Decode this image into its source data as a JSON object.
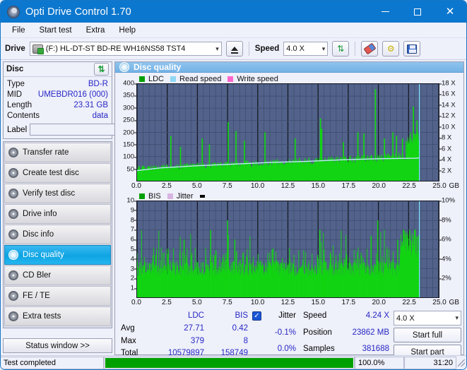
{
  "window": {
    "title": "Opti Drive Control 1.70",
    "icon": "disc-icon",
    "minimize": "—",
    "maximize": "□",
    "close": "✕"
  },
  "menu": [
    {
      "label": "File"
    },
    {
      "label": "Start test"
    },
    {
      "label": "Extra"
    },
    {
      "label": "Help"
    }
  ],
  "toolbar": {
    "drive_label": "Drive",
    "drive_value": "(F:)  HL-DT-ST BD-RE  WH16NS58 TST4",
    "eject_tooltip": "Eject",
    "speed_label": "Speed",
    "speed_value": "4.0 X",
    "refresh_icon": "refresh-icon",
    "erase_icon": "eraser-icon",
    "tools_icon": "wrench-icon",
    "save_icon": "save-icon"
  },
  "disc": {
    "panel_title": "Disc",
    "rows": [
      {
        "key": "Type",
        "value": "BD-R"
      },
      {
        "key": "MID",
        "value": "UMEBDR016 (000)"
      },
      {
        "key": "Length",
        "value": "23.31 GB"
      },
      {
        "key": "Contents",
        "value": "data"
      }
    ],
    "label_key": "Label",
    "label_value": "",
    "label_placeholder": ""
  },
  "nav": {
    "items": [
      {
        "label": "Transfer rate",
        "active": false
      },
      {
        "label": "Create test disc",
        "active": false
      },
      {
        "label": "Verify test disc",
        "active": false
      },
      {
        "label": "Drive info",
        "active": false
      },
      {
        "label": "Disc info",
        "active": false
      },
      {
        "label": "Disc quality",
        "active": true
      },
      {
        "label": "CD Bler",
        "active": false
      },
      {
        "label": "FE / TE",
        "active": false
      },
      {
        "label": "Extra tests",
        "active": false
      }
    ],
    "status_window": "Status window >>"
  },
  "content": {
    "header": "Disc quality",
    "header_icon": "disc-quality-icon"
  },
  "chart_data": [
    {
      "id": "ldc-chart",
      "type": "area",
      "title": "",
      "xlabel": "GB",
      "ylabel": "",
      "xlim": [
        0,
        25.0
      ],
      "ylim": [
        0,
        400
      ],
      "y2lim": [
        0,
        18
      ],
      "grid": true,
      "legend_position": "top-left",
      "xticks": [
        "0.0",
        "2.5",
        "5.0",
        "7.5",
        "10.0",
        "12.5",
        "15.0",
        "17.5",
        "20.0",
        "22.5",
        "25.0"
      ],
      "yticks": [
        "50",
        "100",
        "150",
        "200",
        "250",
        "300",
        "350",
        "400"
      ],
      "y2ticks": [
        "2 X",
        "4 X",
        "6 X",
        "8 X",
        "10 X",
        "12 X",
        "14 X",
        "16 X",
        "18 X"
      ],
      "legend": [
        {
          "name": "LDC",
          "color": "#00a000"
        },
        {
          "name": "Read speed",
          "color": "#8fd6f4"
        },
        {
          "name": "Write speed",
          "color": "#ff66cc"
        }
      ],
      "series": [
        {
          "name": "LDC",
          "color": "#00c000",
          "kind": "spike-area",
          "x_end": 23.4,
          "baseline": [
            48,
            52,
            50,
            54,
            52,
            56,
            54,
            58,
            56,
            60,
            58,
            62,
            60,
            62,
            64,
            62,
            66,
            64,
            68,
            66,
            70,
            68,
            70,
            72,
            70,
            74,
            72,
            74,
            76,
            74,
            78,
            76,
            80,
            78,
            82,
            80,
            84,
            82,
            86,
            84,
            88,
            86,
            90,
            88,
            92,
            90,
            94,
            92,
            96,
            94,
            98,
            100,
            110
          ],
          "max": 379,
          "avg": 27.71,
          "total": 10579897
        },
        {
          "name": "Read speed",
          "color": "#a9e2f7",
          "kind": "line",
          "values_x": [
            0.0,
            2.0,
            5.0,
            8.0,
            11.0,
            14.0,
            17.0,
            20.0,
            23.0,
            23.4
          ],
          "values_y": [
            1.9,
            2.4,
            2.8,
            3.1,
            3.4,
            3.6,
            3.9,
            4.1,
            4.2,
            4.24
          ],
          "units": "X"
        }
      ]
    },
    {
      "id": "bis-chart",
      "type": "area",
      "title": "",
      "xlabel": "GB",
      "ylabel": "",
      "xlim": [
        0,
        25.0
      ],
      "ylim": [
        0,
        10
      ],
      "y2lim": [
        0,
        10
      ],
      "grid": true,
      "legend_position": "top-left",
      "xticks": [
        "0.0",
        "2.5",
        "5.0",
        "7.5",
        "10.0",
        "12.5",
        "15.0",
        "17.5",
        "20.0",
        "22.5",
        "25.0"
      ],
      "yticks": [
        "1",
        "2",
        "3",
        "4",
        "5",
        "6",
        "7",
        "8",
        "9",
        "10"
      ],
      "y2ticks": [
        "2%",
        "4%",
        "6%",
        "8%",
        "10%"
      ],
      "legend": [
        {
          "name": "BIS",
          "color": "#00a000"
        },
        {
          "name": "Jitter",
          "color": "#d8b4e2"
        }
      ],
      "series": [
        {
          "name": "BIS",
          "color": "#00c000",
          "kind": "spike-area",
          "x_end": 23.4,
          "baseline_level": 3,
          "peak_level": 8,
          "max": 8,
          "avg": 0.42,
          "total": 158749
        },
        {
          "name": "Jitter",
          "color": "#d8b4e2",
          "kind": "line",
          "min_pct": -0.1,
          "max_pct": 0.0
        }
      ]
    }
  ],
  "stats": {
    "col_headers": [
      "",
      "LDC",
      "BIS"
    ],
    "rows": [
      {
        "label": "Avg",
        "ldc": "27.71",
        "bis": "0.42"
      },
      {
        "label": "Max",
        "ldc": "379",
        "bis": "8"
      },
      {
        "label": "Total",
        "ldc": "10579897",
        "bis": "158749"
      }
    ],
    "jitter": {
      "checked": true,
      "check_glyph": "✓",
      "label": "Jitter",
      "min": "-0.1%",
      "max": "0.0%"
    },
    "speed_label": "Speed",
    "speed_value": "4.24 X",
    "position_label": "Position",
    "position_value": "23862 MB",
    "samples_label": "Samples",
    "samples_value": "381688",
    "speed_select": "4.0 X",
    "start_full": "Start full",
    "start_part": "Start part"
  },
  "statusbar": {
    "message": "Test completed",
    "percent": "100.0%",
    "progress": 100,
    "time": "31:20"
  }
}
